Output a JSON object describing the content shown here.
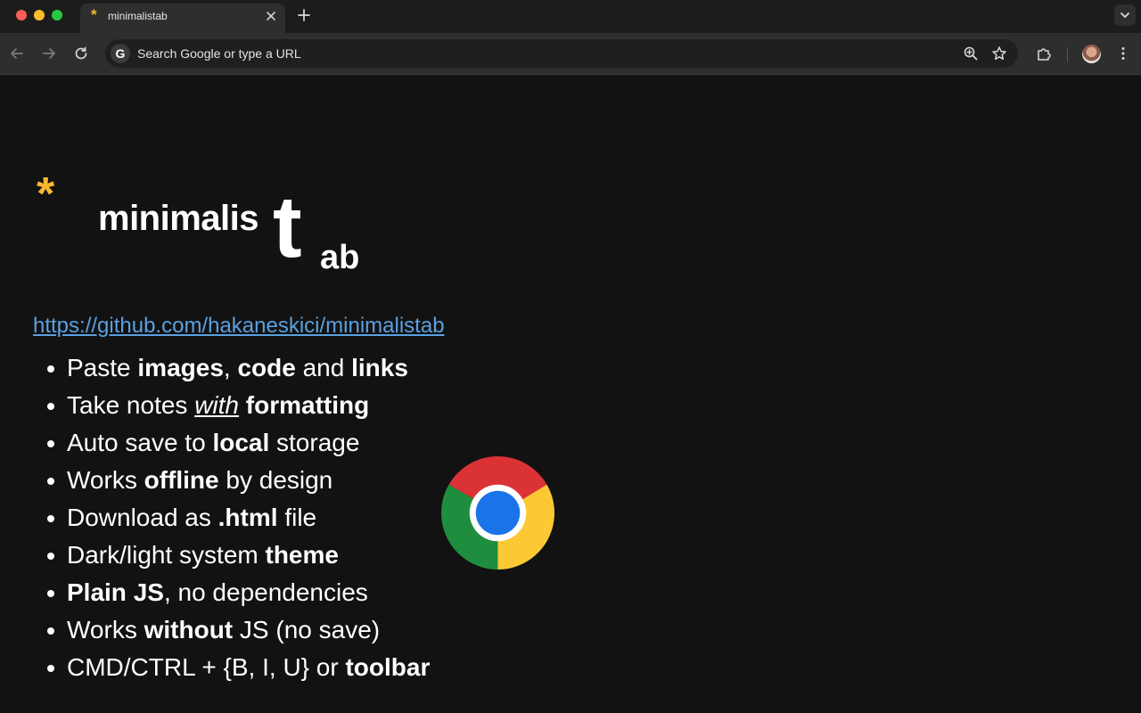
{
  "browser": {
    "tab": {
      "favicon": "*",
      "title": "minimalistab",
      "close_icon": "close-icon"
    },
    "new_tab_icon": "plus-icon",
    "omnibox": {
      "engine_icon": "G",
      "placeholder": "Search Google or type a URL"
    },
    "colors": {
      "tabstrip": "#1c1c1c",
      "toolbar": "#2e2e2e",
      "omnibox": "#1f1f1f",
      "page": "#121212"
    }
  },
  "page": {
    "logo": {
      "star": "*",
      "main": "minimalis",
      "big_letter": "t",
      "sub": "ab",
      "accent_color": "#f5b82e"
    },
    "repo_link": "https://github.com/hakaneskici/minimalistab",
    "link_color": "#5aa0e0",
    "features": [
      [
        {
          "t": "Paste "
        },
        {
          "t": "images",
          "b": true
        },
        {
          "t": ", "
        },
        {
          "t": "code",
          "b": true
        },
        {
          "t": " and "
        },
        {
          "t": "links",
          "b": true
        }
      ],
      [
        {
          "t": "Take notes "
        },
        {
          "t": "with",
          "iu": true
        },
        {
          "t": " "
        },
        {
          "t": "formatting",
          "b": true
        }
      ],
      [
        {
          "t": "Auto save to "
        },
        {
          "t": "local",
          "b": true
        },
        {
          "t": " storage"
        }
      ],
      [
        {
          "t": "Works "
        },
        {
          "t": "offline",
          "b": true
        },
        {
          "t": " by design"
        }
      ],
      [
        {
          "t": "Download as "
        },
        {
          "t": ".html",
          "b": true
        },
        {
          "t": " file"
        }
      ],
      [
        {
          "t": "Dark/light system "
        },
        {
          "t": "theme",
          "b": true
        }
      ],
      [
        {
          "t": "Plain JS",
          "b": true
        },
        {
          "t": ", no dependencies"
        }
      ],
      [
        {
          "t": "Works "
        },
        {
          "t": "without",
          "b": true
        },
        {
          "t": " JS (no save)"
        }
      ],
      [
        {
          "t": "CMD/CTRL + {B, I, U} or "
        },
        {
          "t": "toolbar",
          "b": true
        }
      ]
    ],
    "image_icon": "chrome-logo-icon"
  }
}
